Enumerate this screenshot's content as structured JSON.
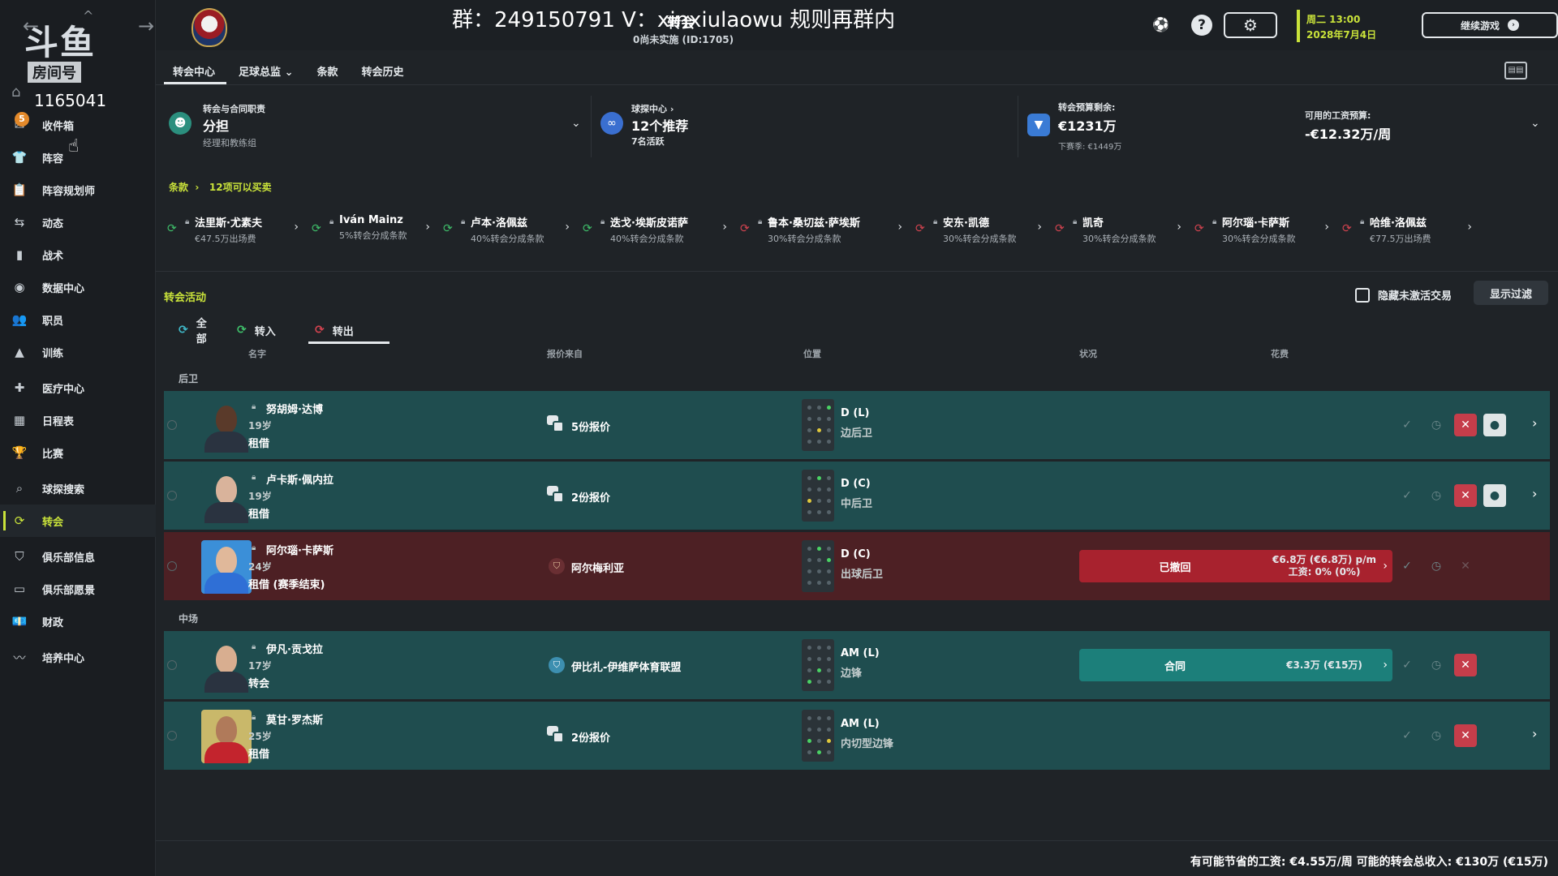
{
  "overlay": {
    "stream_text": "群：249150791 V：xinxiulaowu 规则再群内",
    "logo_text": "斗鱼",
    "logo_sub": "房间号",
    "room_number": "1165041"
  },
  "sidebar": {
    "inbox_badge": "5",
    "items": [
      {
        "label": "收件箱",
        "icon": "inbox-icon",
        "glyph": "✉"
      },
      {
        "label": "阵容",
        "icon": "shirt-icon",
        "glyph": "👕"
      },
      {
        "label": "阵容规划师",
        "icon": "clipboard-icon",
        "glyph": "📋"
      },
      {
        "label": "动态",
        "icon": "dynamics-icon",
        "glyph": "⇆"
      },
      {
        "label": "战术",
        "icon": "tactics-icon",
        "glyph": "▮"
      },
      {
        "label": "数据中心",
        "icon": "data-hub-icon",
        "glyph": "◉"
      },
      {
        "label": "职员",
        "icon": "staff-icon",
        "glyph": "👥"
      },
      {
        "label": "训练",
        "icon": "training-icon",
        "glyph": "▲"
      },
      {
        "label": "医疗中心",
        "icon": "medical-icon",
        "glyph": "✚"
      },
      {
        "label": "日程表",
        "icon": "calendar-icon",
        "glyph": "▦"
      },
      {
        "label": "比赛",
        "icon": "trophy-icon",
        "glyph": "🏆"
      },
      {
        "label": "球探搜索",
        "icon": "search-icon",
        "glyph": "⌕"
      },
      {
        "label": "转会",
        "icon": "transfers-icon",
        "glyph": "⟳"
      },
      {
        "label": "俱乐部信息",
        "icon": "club-shield-icon",
        "glyph": "⛉"
      },
      {
        "label": "俱乐部愿景",
        "icon": "club-vision-icon",
        "glyph": "▭"
      },
      {
        "label": "财政",
        "icon": "finance-icon",
        "glyph": "💶"
      },
      {
        "label": "培养中心",
        "icon": "development-icon",
        "glyph": "〰"
      }
    ],
    "active_index": 12
  },
  "header": {
    "title": "转会",
    "subtitle": "0尚未实施 (ID:1705)",
    "date_line1": "周二 13:00",
    "date_line2": "2028年7月4日",
    "continue_label": "继续游戏"
  },
  "tabs": [
    "转会中心",
    "足球总监",
    "条款",
    "转会历史"
  ],
  "info": {
    "responsibility_label": "转会与合同职责",
    "responsibility_value": "分担",
    "responsibility_sub": "经理和教练组",
    "scouting_label": "球探中心",
    "scouting_value": "12个推荐",
    "scouting_sub": "7名活跃",
    "budget_label": "转会预算剩余:",
    "budget_value": "€1231万",
    "budget_sub": "下赛季: €1449万",
    "wage_label": "可用的工资预算:",
    "wage_value": "-€12.32万/周"
  },
  "clauses": {
    "crumb_link": "条款",
    "crumb_text": "12项可以买卖",
    "items": [
      {
        "name": "法里斯·尤素夫",
        "desc": "€47.5万出场费",
        "type": "in"
      },
      {
        "name": "Iván Mainz",
        "desc": "5%转会分成条款",
        "type": "in"
      },
      {
        "name": "卢本·洛佩兹",
        "desc": "40%转会分成条款",
        "type": "in"
      },
      {
        "name": "迭戈·埃斯皮诺萨",
        "desc": "40%转会分成条款",
        "type": "in"
      },
      {
        "name": "鲁本·桑切兹·萨埃斯",
        "desc": "30%转会分成条款",
        "type": "out"
      },
      {
        "name": "安东·凯德",
        "desc": "30%转会分成条款",
        "type": "out"
      },
      {
        "name": "凯奇",
        "desc": "30%转会分成条款",
        "type": "out"
      },
      {
        "name": "阿尔瑙·卡萨斯",
        "desc": "30%转会分成条款",
        "type": "out"
      },
      {
        "name": "哈维·洛佩兹",
        "desc": "€77.5万出场费",
        "type": "out"
      }
    ]
  },
  "activity": {
    "title": "转会活动",
    "hide_inactive_label": "隐藏未激活交易",
    "show_filter_label": "显示过滤",
    "tabs": [
      {
        "label": "全部",
        "icon": "all-transfers-icon"
      },
      {
        "label": "转入",
        "icon": "transfer-in-icon"
      },
      {
        "label": "转出",
        "icon": "transfer-out-icon"
      }
    ],
    "active_tab": 2,
    "columns": [
      "名字",
      "报价来自",
      "位置",
      "状况",
      "花费"
    ],
    "groups": [
      "后卫",
      "中场"
    ],
    "rows": [
      {
        "name": "努胡姆·达博",
        "age": "19岁",
        "type": "租借",
        "offer": "5份报价",
        "offer_kind": "offers",
        "pos_code": "D (L)",
        "pos_name": "边后卫",
        "status": "",
        "fee": "",
        "style": "normal"
      },
      {
        "name": "卢卡斯·佩内拉",
        "age": "19岁",
        "type": "租借",
        "offer": "2份报价",
        "offer_kind": "offers",
        "pos_code": "D (C)",
        "pos_name": "中后卫",
        "status": "",
        "fee": "",
        "style": "normal"
      },
      {
        "name": "阿尔瑙·卡萨斯",
        "age": "24岁",
        "type": "租借 (赛季结束)",
        "offer": "阿尔梅利亚",
        "offer_kind": "club",
        "pos_code": "D (C)",
        "pos_name": "出球后卫",
        "status": "已撤回",
        "fee_line1": "€6.8万 (€6.8万) p/m",
        "fee_line2": "工资: 0% (0%)",
        "style": "withdrawn"
      },
      {
        "name": "伊凡·贡戈拉",
        "age": "17岁",
        "type": "转会",
        "offer": "伊比扎-伊维萨体育联盟",
        "offer_kind": "club",
        "pos_code": "AM (L)",
        "pos_name": "边锋",
        "status": "合同",
        "fee_line1": "€3.3万 (€15万)",
        "fee_line2": "",
        "style": "contract"
      },
      {
        "name": "莫甘·罗杰斯",
        "age": "25岁",
        "type": "租借",
        "offer": "2份报价",
        "offer_kind": "offers",
        "pos_code": "AM (L)",
        "pos_name": "内切型边锋",
        "status": "",
        "fee": "",
        "style": "normal"
      }
    ]
  },
  "footer": {
    "text": "有可能节省的工资: €4.55万/周 可能的转会总收入: €130万 (€15万)"
  },
  "colors": {
    "accent": "#c9e23a",
    "row_teal": "#1f4d4f",
    "row_red": "#4d2024",
    "decline": "#c53d4a",
    "contract": "#1c7f7a",
    "withdrawn": "#a8222e"
  }
}
